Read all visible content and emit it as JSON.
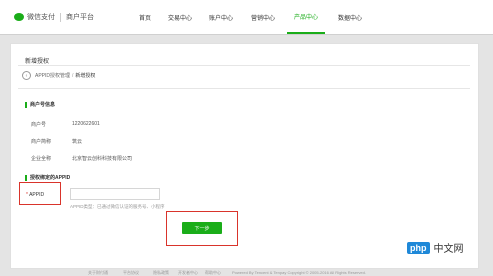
{
  "header": {
    "logo_text": "微信支付",
    "logo_subtitle": "商户平台",
    "nav": [
      {
        "label": "首页"
      },
      {
        "label": "交易中心"
      },
      {
        "label": "账户中心"
      },
      {
        "label": "营销中心"
      },
      {
        "label": "产品中心",
        "active": true
      },
      {
        "label": "数据中心"
      }
    ]
  },
  "page": {
    "title": "新增授权",
    "breadcrumb": {
      "parent": "APPID授权管理",
      "separator": "/",
      "current": "新增授权"
    }
  },
  "merchant_section": {
    "heading": "商户号信息",
    "rows": [
      {
        "label": "商户号",
        "value": "1220622601"
      },
      {
        "label": "商户简称",
        "value": "筑云"
      },
      {
        "label": "企业全称",
        "value": "北京智云创科科技有限公司"
      }
    ]
  },
  "appid_section": {
    "heading": "授权绑定的APPID",
    "field_label": "APPID",
    "required_mark": "*",
    "input_value": "",
    "hint": "APPID类型：已通过微信认证的服务号、小程序"
  },
  "actions": {
    "next_label": "下一步"
  },
  "footer": {
    "links": [
      "关于财付通",
      "平台协议",
      "隐私政策",
      "开发者中心",
      "帮助中心"
    ],
    "powered": "Powered By Tencent & Tenpay   Copyright © 2005-2016 All Rights Reserved."
  },
  "watermark": {
    "badge": "php",
    "text": "中文网"
  },
  "colors": {
    "accent": "#1aad19",
    "highlight": "#d9342b",
    "watermark": "#1e88d8"
  }
}
